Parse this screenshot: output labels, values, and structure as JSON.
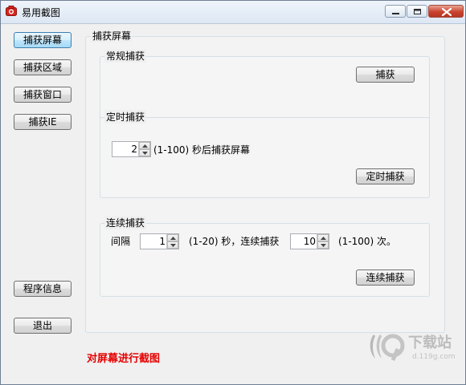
{
  "window": {
    "title": "易用截图"
  },
  "sidebar": {
    "capture_screen": "捕获屏幕",
    "capture_region": "捕获区域",
    "capture_window": "捕获窗口",
    "capture_ie": "捕获IE",
    "program_info": "程序信息",
    "exit": "退出"
  },
  "panel": {
    "title": "捕获屏幕",
    "normal": {
      "title": "常规捕获",
      "button": "捕获"
    },
    "timed": {
      "title": "定时捕获",
      "delay_value": "2",
      "delay_hint": "(1-100) 秒后捕获屏幕",
      "button": "定时捕获"
    },
    "continuous": {
      "title": "连续捕获",
      "interval_label": "间隔",
      "interval_value": "1",
      "interval_hint": "(1-20) 秒，连续捕获",
      "count_value": "10",
      "count_hint": "(1-100) 次。",
      "button": "连续捕获"
    }
  },
  "status": {
    "text": "对屏幕进行截图",
    "color": "#e60000"
  },
  "watermark": {
    "brand": "下载站",
    "domain": "d.119g.com"
  },
  "icons": {
    "app": "camera-icon",
    "minimize": "minimize-icon",
    "maximize": "maximize-icon",
    "close": "close-icon",
    "spin_up": "arrow-up-icon",
    "spin_down": "arrow-down-icon"
  }
}
